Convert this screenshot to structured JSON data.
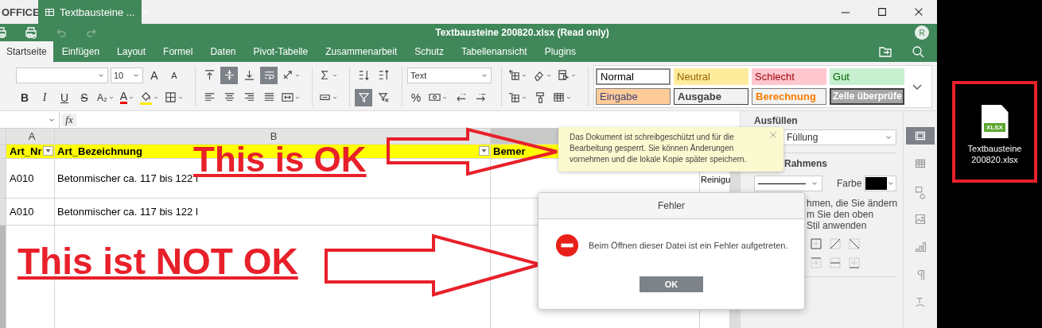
{
  "app_tabs": {
    "brand": "OFFICE",
    "document_tab": "Textbausteine ..."
  },
  "header": {
    "tools": [
      {
        "kind": "print",
        "disabled": false
      },
      {
        "kind": "print-preview",
        "disabled": false
      },
      {
        "kind": "undo",
        "disabled": true
      },
      {
        "kind": "redo",
        "disabled": true
      }
    ],
    "title": "Textbausteine 200820.xlsx (Read only)",
    "avatar": "R"
  },
  "menu": [
    {
      "label": "Startseite",
      "selected": true
    },
    {
      "label": "Einfügen",
      "selected": false
    },
    {
      "label": "Layout",
      "selected": false
    },
    {
      "label": "Formel",
      "selected": false
    },
    {
      "label": "Daten",
      "selected": false
    },
    {
      "label": "Pivot-Tabelle",
      "selected": false
    },
    {
      "label": "Zusammenarbeit",
      "selected": false
    },
    {
      "label": "Schutz",
      "selected": false
    },
    {
      "label": "Tabellenansicht",
      "selected": false
    },
    {
      "label": "Plugins",
      "selected": false
    }
  ],
  "ribbon": {
    "groups": [
      {
        "top": [
          {
            "kind": "font-select"
          },
          {
            "kind": "size-select",
            "value": "10"
          },
          {
            "kind": "grow",
            "label": "A"
          },
          {
            "kind": "shrink",
            "label": "A"
          }
        ],
        "bottom": [
          {
            "kind": "bold",
            "label": "B",
            "on": false
          },
          {
            "kind": "italic",
            "label": "I",
            "on": false
          },
          {
            "kind": "underline",
            "label": "U",
            "on": false
          },
          {
            "kind": "strike",
            "label": "S",
            "on": false
          },
          {
            "kind": "subscript",
            "label": "A₂",
            "on": false
          },
          {
            "kind": "font-color",
            "label": "A"
          },
          {
            "kind": "fill"
          },
          {
            "kind": "borders"
          }
        ]
      },
      {
        "top": [
          {
            "kind": "align-top",
            "on": false
          },
          {
            "kind": "align-middle",
            "on": true
          },
          {
            "kind": "align-bottom",
            "on": false
          },
          {
            "kind": "wrap",
            "on": true
          },
          {
            "kind": "orientation"
          }
        ],
        "bottom": [
          {
            "kind": "align-left",
            "on": false
          },
          {
            "kind": "align-center",
            "on": false
          },
          {
            "kind": "align-right",
            "on": false
          },
          {
            "kind": "justify",
            "on": false
          },
          {
            "kind": "merge"
          }
        ]
      },
      {
        "top": [
          {
            "kind": "sum"
          }
        ],
        "bottom": [
          {
            "kind": "named-range"
          }
        ]
      },
      {
        "top": [
          {
            "kind": "sort-asc"
          },
          {
            "kind": "sort-desc"
          }
        ],
        "bottom": [
          {
            "kind": "filter",
            "on": true
          },
          {
            "kind": "clear-filter",
            "on": false
          }
        ]
      },
      {
        "top": [
          {
            "kind": "format-select",
            "value": "Text"
          }
        ],
        "bottom": [
          {
            "kind": "percent",
            "label": "%"
          },
          {
            "kind": "currency"
          },
          {
            "kind": "decrease-decimal"
          },
          {
            "kind": "increase-decimal"
          }
        ]
      },
      {
        "top": [
          {
            "kind": "insert-cells"
          },
          {
            "kind": "eraser"
          },
          {
            "kind": "conditional"
          }
        ],
        "bottom": [
          {
            "kind": "delete-cells"
          },
          {
            "kind": "format-painter"
          },
          {
            "kind": "table"
          }
        ]
      }
    ],
    "cell_styles": [
      {
        "label": "Normal",
        "kind": "normal"
      },
      {
        "label": "Neutral",
        "kind": "neutral"
      },
      {
        "label": "Schlecht",
        "kind": "bad"
      },
      {
        "label": "Gut",
        "kind": "good"
      },
      {
        "label": "Eingabe",
        "kind": "input"
      },
      {
        "label": "Ausgabe",
        "kind": "output"
      },
      {
        "label": "Berechnung",
        "kind": "calculation"
      },
      {
        "label": "Zelle überprüfe",
        "kind": "check"
      }
    ]
  },
  "formula_bar": {
    "function_label": "fx"
  },
  "sheet": {
    "column_headers": [
      "A",
      "B"
    ],
    "header_row": [
      {
        "label": "Art_Nr",
        "filter": true
      },
      {
        "label": "Art_Bezeichnung",
        "filter": true
      },
      {
        "label": "Bemer",
        "filter": false
      }
    ],
    "rows": [
      {
        "art_nr": "A010",
        "bezeichnung": "Betonmischer ca. 117 bis 122 l",
        "column_4": "Reinigu"
      },
      {
        "art_nr": "A010",
        "bezeichnung": "Betonmischer ca. 117 bis 122 l"
      }
    ]
  },
  "right_panel": {
    "fill_label": "Ausfüllen",
    "fill_value": "Füllung",
    "border_label": "Rahmens",
    "color_label": "Farbe",
    "border_hint_lines": [
      "hmen, die Sie ändern",
      "m Sie den oben",
      "Stil anwenden"
    ]
  },
  "sidebar": [
    {
      "kind": "cell",
      "selected": true
    },
    {
      "kind": "grid",
      "selected": false
    },
    {
      "kind": "shapes",
      "selected": false
    },
    {
      "kind": "image",
      "selected": false
    },
    {
      "kind": "chart",
      "selected": false
    },
    {
      "kind": "paragraph",
      "selected": false
    },
    {
      "kind": "text-art",
      "selected": false
    }
  ],
  "tooltip": {
    "text": "Das Dokument ist schreibgeschützt und für die Bearbeitung gesperrt. Sie können Änderungen vornehmen und die lokale Kopie später speichern."
  },
  "dialog": {
    "title": "Fehler",
    "message": "Beim Öffnen dieser Datei ist ein Fehler aufgetreten.",
    "button": "OK"
  },
  "annotations": [
    {
      "text": "This is OK"
    },
    {
      "text": "This ist NOT OK"
    }
  ],
  "desktop_icon": {
    "badge": "XLSX",
    "label": "Textbausteine 200820.xlsx"
  }
}
